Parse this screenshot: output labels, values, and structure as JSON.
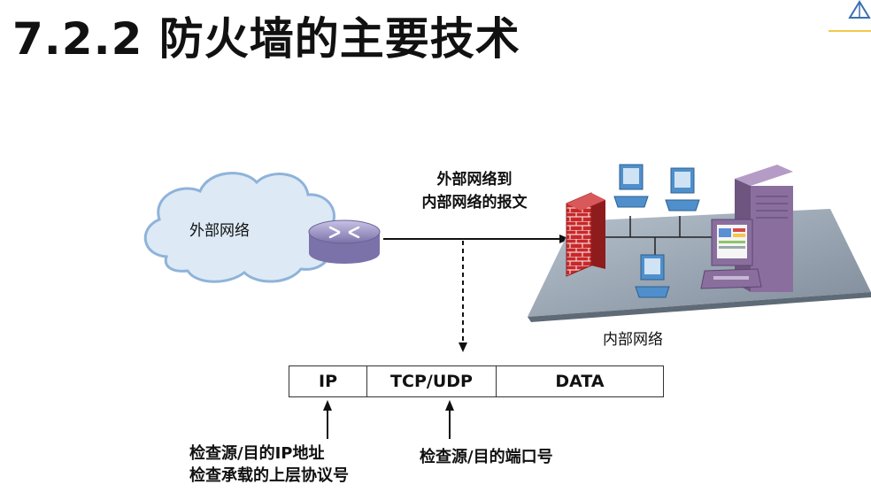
{
  "slide": {
    "title": "7.2.2 防火墙的主要技术"
  },
  "diagram": {
    "external_network_label": "外部网络",
    "flow_label_line1": "外部网络到",
    "flow_label_line2": "内部网络的报文",
    "internal_network_label": "内部网络"
  },
  "packet": {
    "fields": [
      "IP",
      "TCP/UDP",
      "DATA"
    ]
  },
  "annotations": {
    "ip_check_line1": "检查源/目的IP地址",
    "ip_check_line2": "检查承载的上层协议号",
    "port_check": "检查源/目的端口号"
  },
  "colors": {
    "cloud_fill": "#ddeaf6",
    "cloud_stroke": "#8fb3d9",
    "router_fill": "#9a93c4",
    "firewall_brick": "#c8282a",
    "platform_fill": "#9ba8b8",
    "server_fill": "#8a6f9e",
    "workstation_fill": "#4f8fcb",
    "accent_line": "#f2c94c"
  }
}
